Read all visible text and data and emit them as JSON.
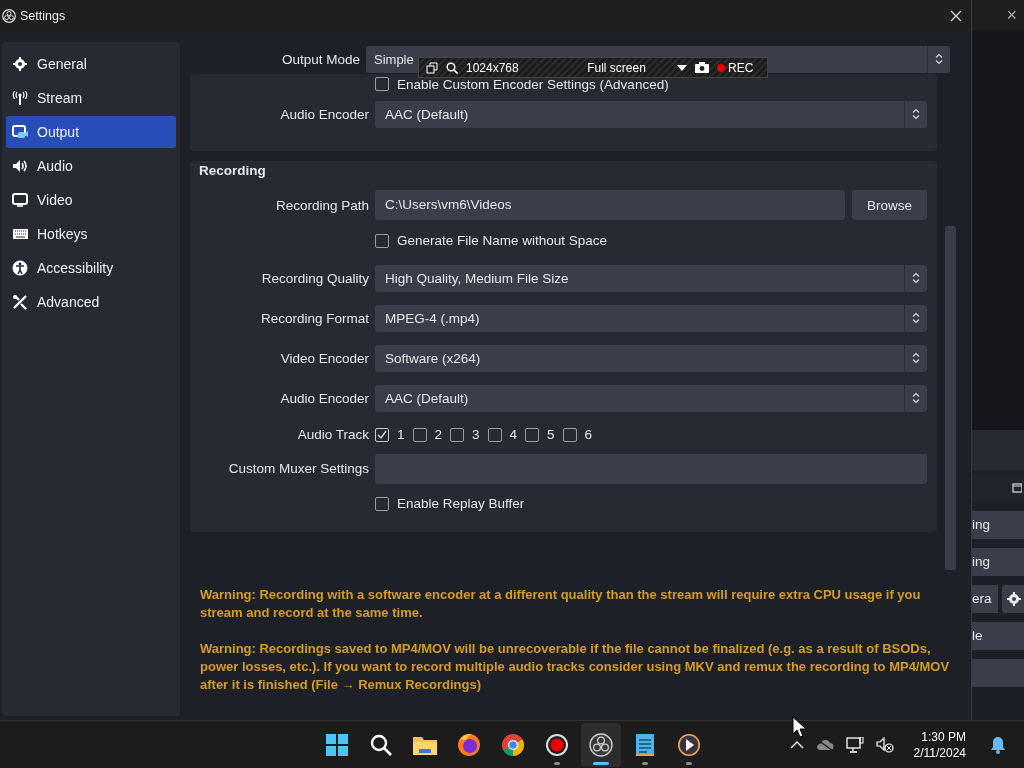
{
  "window": {
    "title": "Settings"
  },
  "sidebar": {
    "items": [
      {
        "label": "General",
        "selected": false
      },
      {
        "label": "Stream",
        "selected": false
      },
      {
        "label": "Output",
        "selected": true
      },
      {
        "label": "Audio",
        "selected": false
      },
      {
        "label": "Video",
        "selected": false
      },
      {
        "label": "Hotkeys",
        "selected": false
      },
      {
        "label": "Accessibility",
        "selected": false
      },
      {
        "label": "Advanced",
        "selected": false
      }
    ]
  },
  "output_mode": {
    "label": "Output Mode",
    "value": "Simple"
  },
  "streaming_group": {
    "rows": [
      {
        "kind": "checkbox",
        "label": "Enable Custom Encoder Settings (Advanced)",
        "checked": false
      },
      {
        "kind": "select",
        "label": "Audio Encoder",
        "value": "AAC (Default)"
      }
    ]
  },
  "recording_group": {
    "title": "Recording",
    "rows": [
      {
        "kind": "path",
        "label": "Recording Path",
        "value": "C:\\Users\\vm6\\Videos",
        "button": "Browse"
      },
      {
        "kind": "checkbox",
        "label": "Generate File Name without Space",
        "checked": false
      },
      {
        "kind": "select",
        "label": "Recording Quality",
        "value": "High Quality, Medium File Size"
      },
      {
        "kind": "select",
        "label": "Recording Format",
        "value": "MPEG-4 (.mp4)"
      },
      {
        "kind": "select",
        "label": "Video Encoder",
        "value": "Software (x264)"
      },
      {
        "kind": "select",
        "label": "Audio Encoder",
        "value": "AAC (Default)"
      },
      {
        "kind": "tracks",
        "label": "Audio Track",
        "tracks": [
          {
            "label": "1",
            "checked": true
          },
          {
            "label": "2",
            "checked": false
          },
          {
            "label": "3",
            "checked": false
          },
          {
            "label": "4",
            "checked": false
          },
          {
            "label": "5",
            "checked": false
          },
          {
            "label": "6",
            "checked": false
          }
        ]
      },
      {
        "kind": "text",
        "label": "Custom Muxer Settings"
      },
      {
        "kind": "checkbox",
        "label": "Enable Replay Buffer",
        "checked": false
      }
    ]
  },
  "warnings": [
    "Warning: Recording with a software encoder at a different quality than the stream will require extra CPU usage if you stream and record at the same time.",
    "Warning: Recordings saved to MP4/MOV will be unrecoverable if the file cannot be finalized (e.g. as a result of BSODs, power losses, etc.). If you want to record multiple audio tracks consider using MKV and remux the recording to MP4/MOV after it is finished (File → Remux Recordings)"
  ],
  "capture_toolbar": {
    "resolution": "1024x768",
    "mode": "Full screen",
    "record": "REC"
  },
  "background_window": {
    "close": "×",
    "items": [
      {
        "kind": "button",
        "label": "ing"
      },
      {
        "kind": "button",
        "label": "ing"
      },
      {
        "kind": "field",
        "label": "era"
      },
      {
        "kind": "button",
        "label": "le"
      },
      {
        "kind": "button"
      }
    ]
  },
  "taskbar": {
    "apps": [
      {
        "kind": "start",
        "running": false,
        "selected": false
      },
      {
        "kind": "search",
        "running": false,
        "selected": false
      },
      {
        "kind": "folder",
        "running": false,
        "selected": false
      },
      {
        "kind": "firefox",
        "running": false,
        "selected": false
      },
      {
        "kind": "chrome",
        "running": false,
        "selected": false
      },
      {
        "kind": "recorder",
        "running": true,
        "selected": false
      },
      {
        "kind": "obs",
        "running": true,
        "selected": true
      },
      {
        "kind": "notepad",
        "running": true,
        "selected": false
      },
      {
        "kind": "player",
        "running": true,
        "selected": false
      }
    ],
    "clock": {
      "time": "1:30 PM",
      "date": "2/11/2024"
    }
  }
}
